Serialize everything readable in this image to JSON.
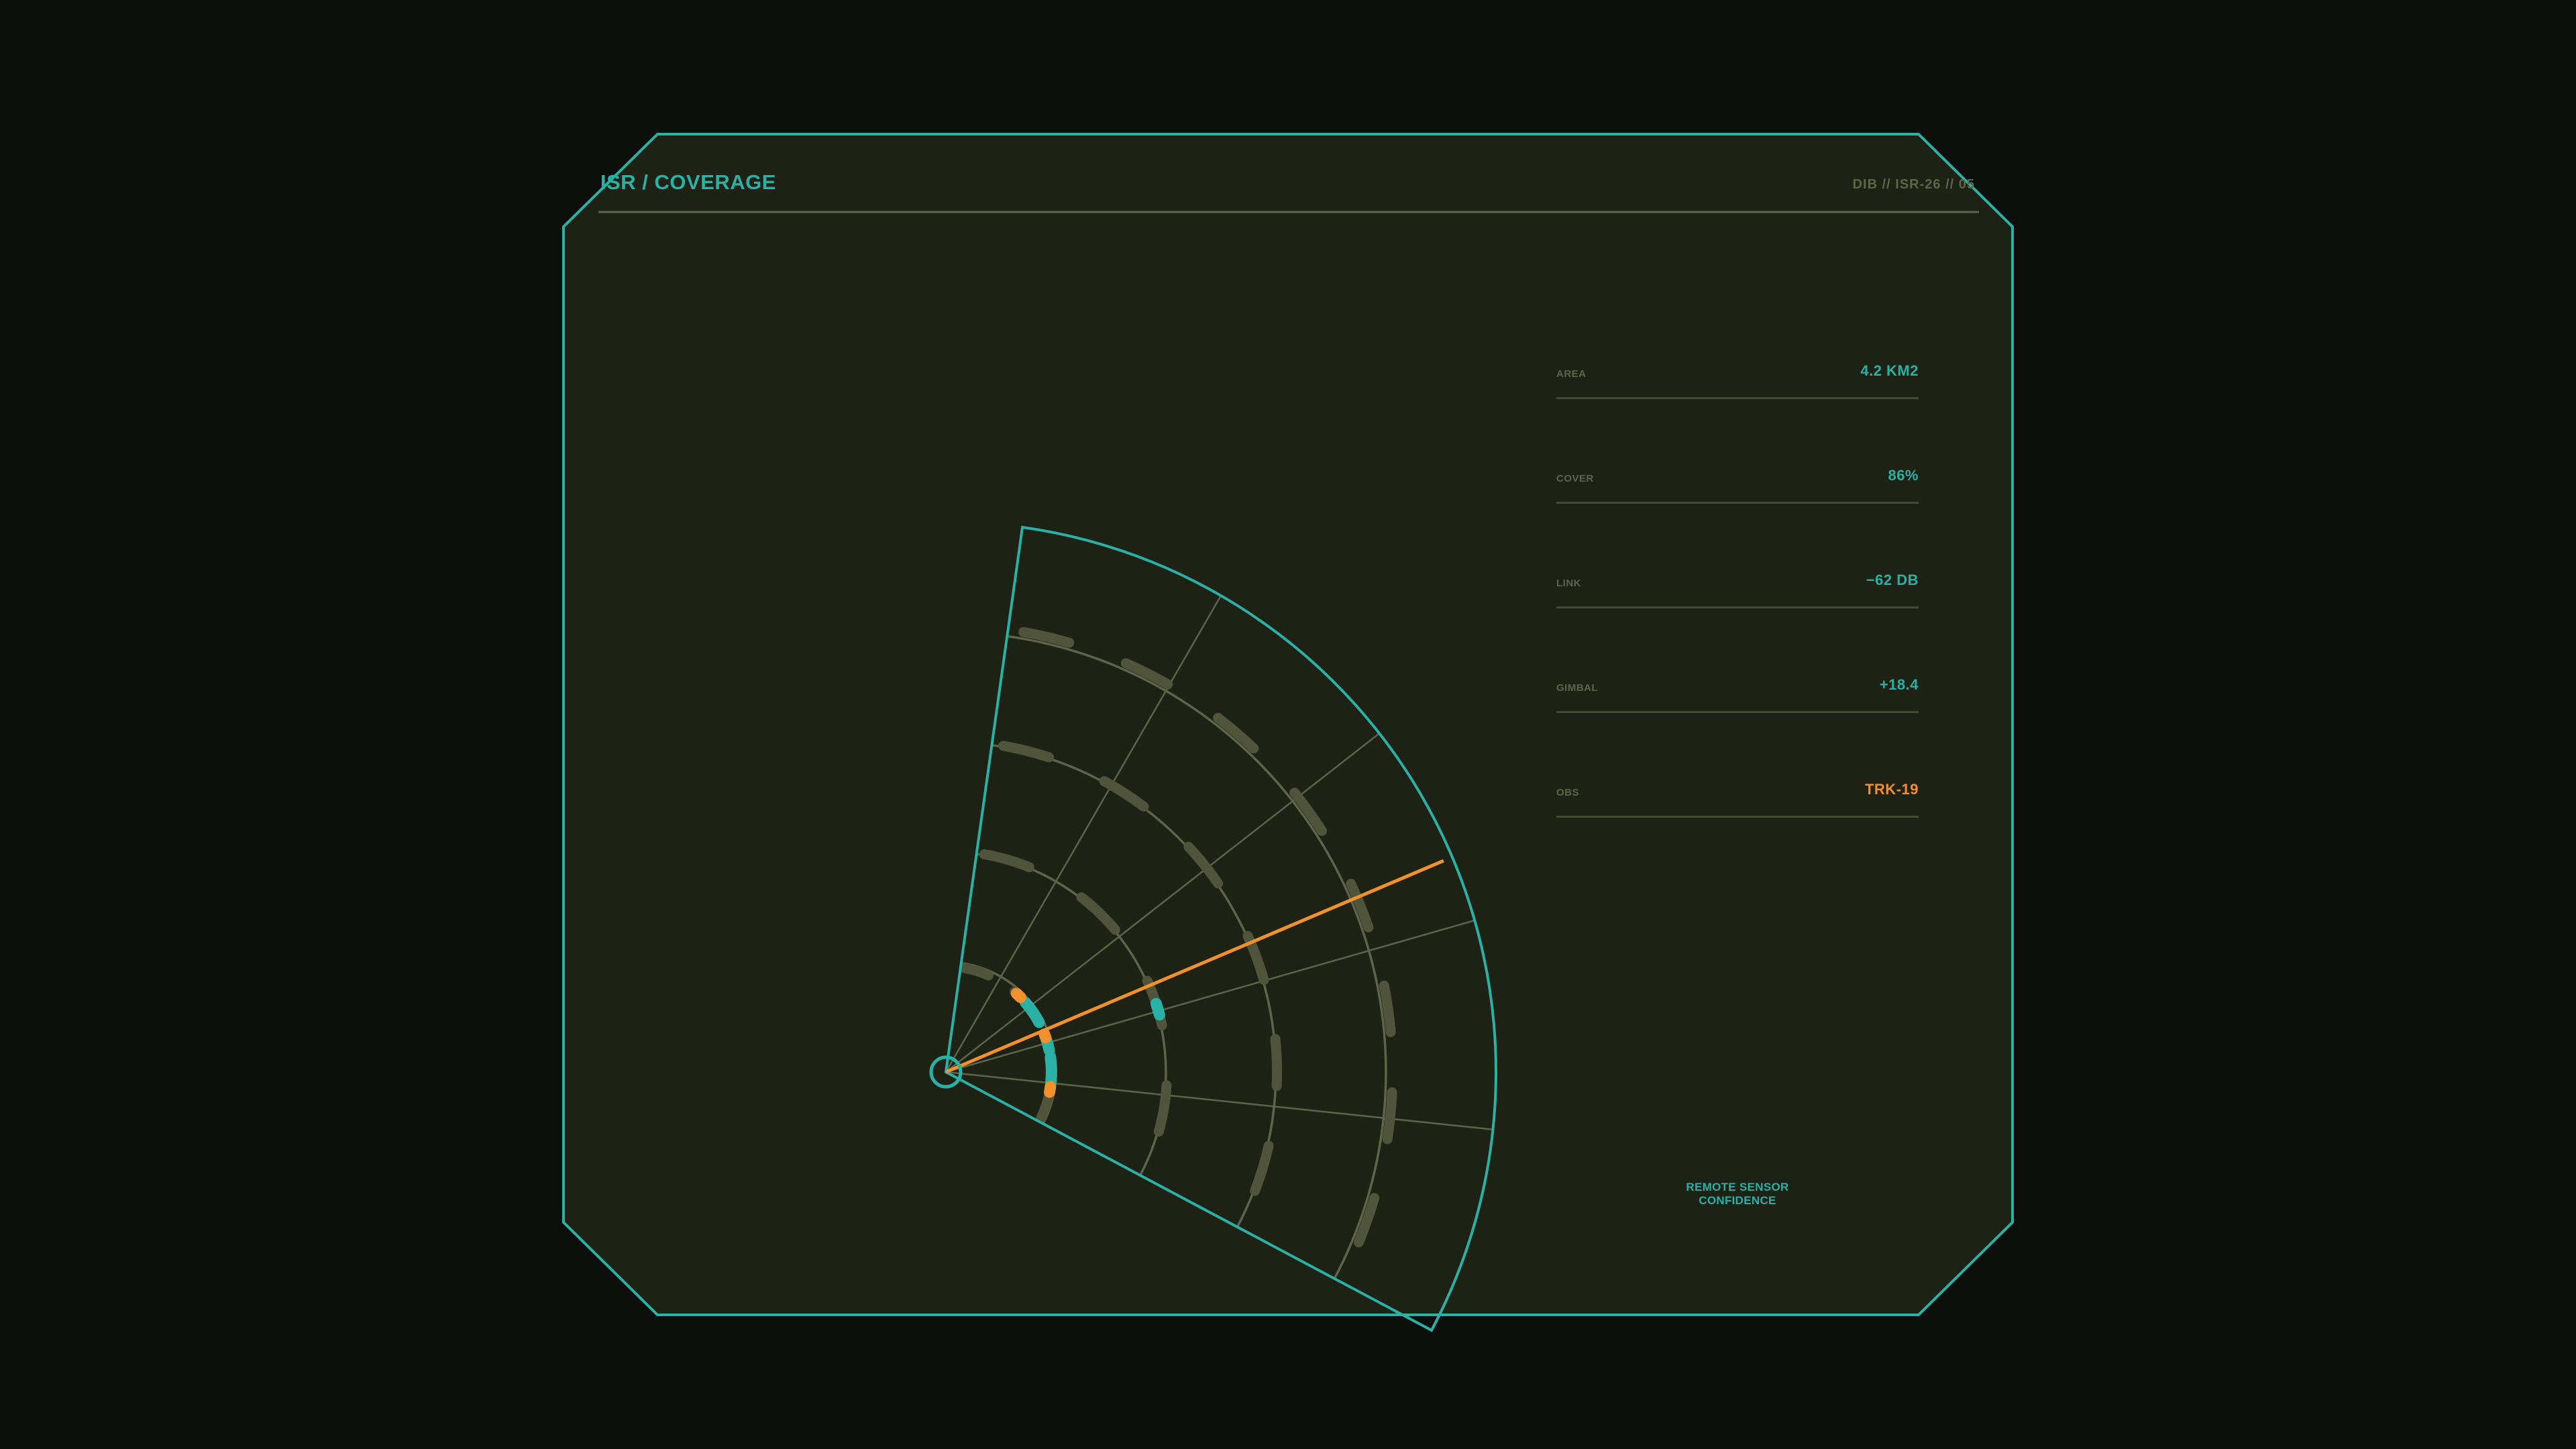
{
  "header": {
    "title": "ISR / COVERAGE",
    "doc_id": "DIB // ISR-26 // 05"
  },
  "stats": [
    {
      "key": "AREA",
      "value": "4.2 KM2",
      "highlight": false
    },
    {
      "key": "COVER",
      "value": "86%",
      "highlight": false
    },
    {
      "key": "LINK",
      "value": "−62 DB",
      "highlight": false
    },
    {
      "key": "GIMBAL",
      "value": "+18.4",
      "highlight": false
    },
    {
      "key": "OBS",
      "value": "TRK-19",
      "highlight": true
    }
  ],
  "caption": "REMOTE SENSOR CONFIDENCE",
  "colors": {
    "background": "#0d0f0d",
    "panel": "#1e2214",
    "accent": "#2bb0a6",
    "alert": "#f0912d",
    "grid": "#5e6449",
    "muted_track": "#4f543b"
  },
  "sweep": {
    "heading_deg": 67,
    "sector_start_deg": 8,
    "sector_end_deg": 118,
    "rings": 5
  }
}
